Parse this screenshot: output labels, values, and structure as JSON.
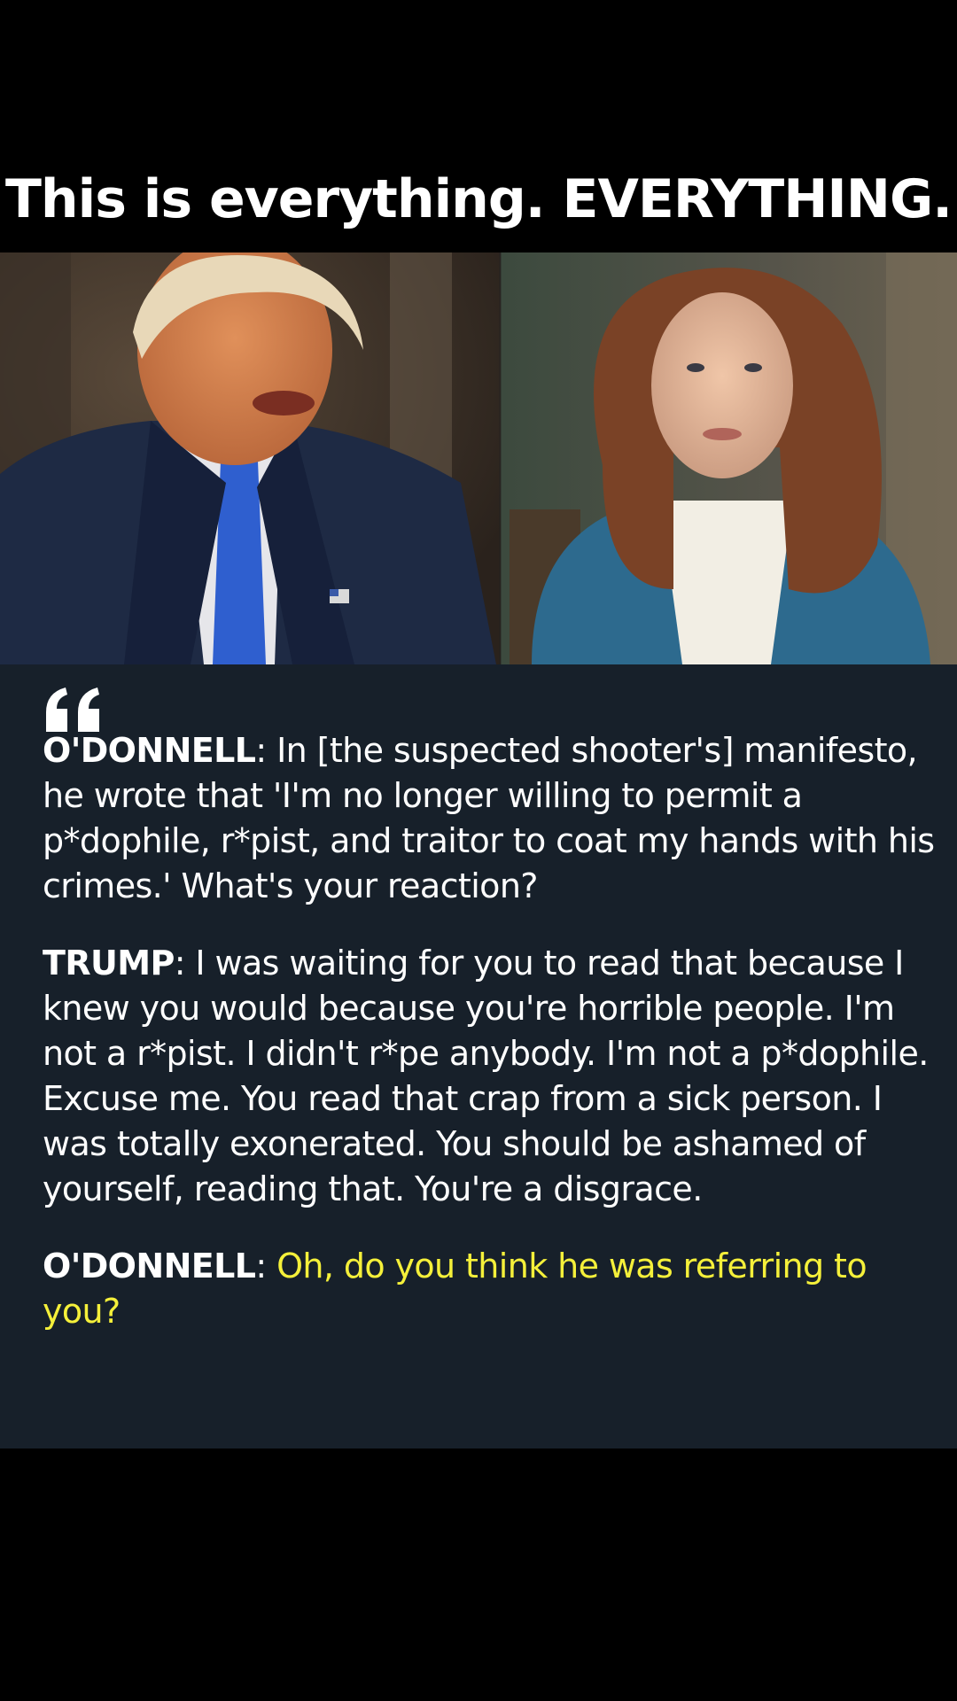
{
  "headline": "This is everything. EVERYTHING.",
  "photo": {
    "icon": "interview-split-photo"
  },
  "quote": {
    "icon": "quote-mark-icon",
    "highlight_color": "#f5f03a",
    "paragraphs": [
      {
        "speaker": "O'DONNELL",
        "separator": ": ",
        "text": "In [the suspected shooter's] manifesto, he wrote that 'I'm no longer willing to permit a p*dophile, r*pist, and traitor to coat my hands with his crimes.' What's your reaction?"
      },
      {
        "speaker": "TRUMP",
        "separator": ": ",
        "text": "I was waiting for you to read that because I knew you would because you're horrible people. I'm not a r*pist. I didn't r*pe anybody. I'm not a p*dophile. Excuse me. You read that crap from a sick person. I was totally exonerated. You should be ashamed of yourself, reading that. You're a disgrace."
      },
      {
        "speaker": "O'DONNELL",
        "separator": ": ",
        "text": "Oh, do you think he was referring to you?"
      }
    ]
  }
}
